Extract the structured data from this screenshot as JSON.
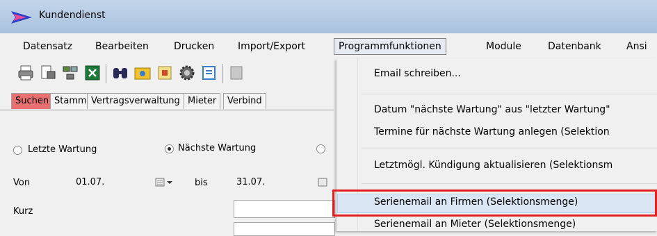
{
  "window": {
    "title": "Kundendienst"
  },
  "menubar": {
    "items": [
      "Datensatz",
      "Bearbeiten",
      "Drucken",
      "Import/Export",
      "Programmfunktionen",
      "Module",
      "Datenbank",
      "Ansi"
    ]
  },
  "toolbar": {
    "icons": [
      "printer-icon",
      "print-preview-icon",
      "network-icon",
      "excel-icon",
      "binoculars-icon",
      "folder-icon",
      "note-icon",
      "gear-icon",
      "ticket-icon",
      "save-icon"
    ]
  },
  "tabs": [
    "Suchen",
    "Stamm",
    "Vertragsverwaltung",
    "Mieter",
    "Verbind"
  ],
  "form": {
    "radio_letzte": "Letzte Wartung",
    "radio_naechste": "Nächste Wartung",
    "von_label": "Von",
    "von_value": "01.07.",
    "bis_label": "bis",
    "bis_value": "31.07.",
    "kurz_label": "Kurz"
  },
  "dropdown": {
    "items": [
      "Email schreiben...",
      "Datum \"nächste Wartung\" aus \"letzter Wartung\"",
      "Termine für nächste Wartung anlegen (Selektion",
      "Letztmögl. Kündigung aktualisieren (Selektionsm",
      "Serienemail an Firmen (Selektionsmenge)",
      "Serienemail an Mieter (Selektionsmenge)"
    ]
  },
  "colors": {
    "active_tab": "#e87070",
    "highlight_box": "#e22020",
    "titlebar": "#b7cce6"
  }
}
